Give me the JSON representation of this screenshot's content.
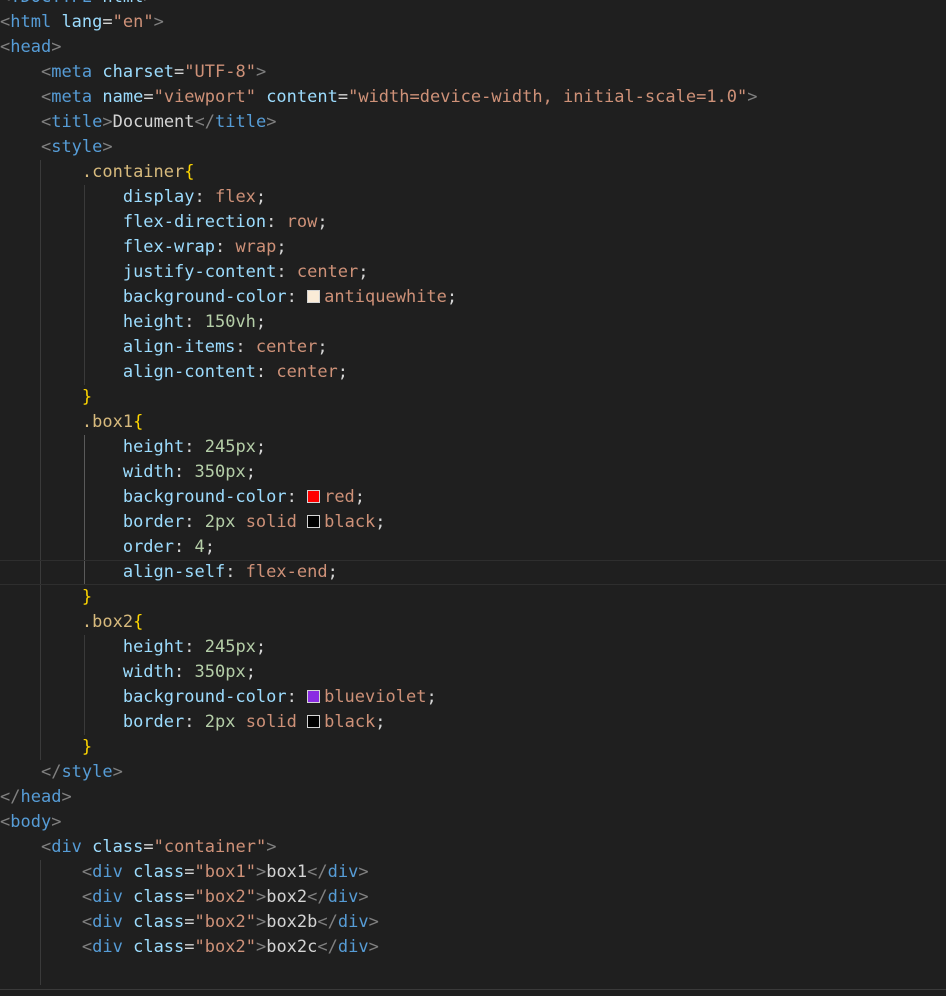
{
  "colors": {
    "background": "#1f1f1f",
    "tag": "#569cd6",
    "attribute": "#9cdcfe",
    "string": "#ce9178",
    "selector": "#d7ba7d",
    "brace": "#ffd700",
    "number": "#b5cea8",
    "swatch_antiquewhite": "#faebd7",
    "swatch_red": "#ff0000",
    "swatch_black": "#000000",
    "swatch_blueviolet": "#8a2be2"
  },
  "lines": [
    [
      {
        "t": "br",
        "v": "<"
      },
      {
        "t": "tag",
        "v": "!DOCTYPE"
      },
      {
        "t": "attr",
        "v": " html"
      },
      {
        "t": "br",
        "v": ">"
      }
    ],
    [
      {
        "t": "br",
        "v": "<"
      },
      {
        "t": "tag",
        "v": "html"
      },
      {
        "t": "attr",
        "v": " lang"
      },
      {
        "t": "text",
        "v": "="
      },
      {
        "t": "str",
        "v": "\"en\""
      },
      {
        "t": "br",
        "v": ">"
      }
    ],
    [
      {
        "t": "br",
        "v": "<"
      },
      {
        "t": "tag",
        "v": "head"
      },
      {
        "t": "br",
        "v": ">"
      }
    ],
    [
      {
        "t": "text",
        "v": "    "
      },
      {
        "t": "br",
        "v": "<"
      },
      {
        "t": "tag",
        "v": "meta"
      },
      {
        "t": "attr",
        "v": " charset"
      },
      {
        "t": "text",
        "v": "="
      },
      {
        "t": "str",
        "v": "\"UTF-8\""
      },
      {
        "t": "br",
        "v": ">"
      }
    ],
    [
      {
        "t": "text",
        "v": "    "
      },
      {
        "t": "br",
        "v": "<"
      },
      {
        "t": "tag",
        "v": "meta"
      },
      {
        "t": "attr",
        "v": " name"
      },
      {
        "t": "text",
        "v": "="
      },
      {
        "t": "str",
        "v": "\"viewport\""
      },
      {
        "t": "attr",
        "v": " content"
      },
      {
        "t": "text",
        "v": "="
      },
      {
        "t": "str",
        "v": "\"width=device-width, initial-scale=1.0\""
      },
      {
        "t": "br",
        "v": ">"
      }
    ],
    [
      {
        "t": "text",
        "v": "    "
      },
      {
        "t": "br",
        "v": "<"
      },
      {
        "t": "tag",
        "v": "title"
      },
      {
        "t": "br",
        "v": ">"
      },
      {
        "t": "text",
        "v": "Document"
      },
      {
        "t": "br",
        "v": "</"
      },
      {
        "t": "tag",
        "v": "title"
      },
      {
        "t": "br",
        "v": ">"
      }
    ],
    [
      {
        "t": "text",
        "v": "    "
      },
      {
        "t": "br",
        "v": "<"
      },
      {
        "t": "tag",
        "v": "style"
      },
      {
        "t": "br",
        "v": ">"
      }
    ],
    [
      {
        "t": "text",
        "v": "        "
      },
      {
        "t": "sel",
        "v": ".container"
      },
      {
        "t": "brace",
        "v": "{"
      }
    ],
    [
      {
        "t": "text",
        "v": "            "
      },
      {
        "t": "prop",
        "v": "display"
      },
      {
        "t": "text",
        "v": ": "
      },
      {
        "t": "val",
        "v": "flex"
      },
      {
        "t": "text",
        "v": ";"
      }
    ],
    [
      {
        "t": "text",
        "v": "            "
      },
      {
        "t": "prop",
        "v": "flex-direction"
      },
      {
        "t": "text",
        "v": ": "
      },
      {
        "t": "val",
        "v": "row"
      },
      {
        "t": "text",
        "v": ";"
      }
    ],
    [
      {
        "t": "text",
        "v": "            "
      },
      {
        "t": "prop",
        "v": "flex-wrap"
      },
      {
        "t": "text",
        "v": ": "
      },
      {
        "t": "val",
        "v": "wrap"
      },
      {
        "t": "text",
        "v": ";"
      }
    ],
    [
      {
        "t": "text",
        "v": "            "
      },
      {
        "t": "prop",
        "v": "justify-content"
      },
      {
        "t": "text",
        "v": ": "
      },
      {
        "t": "val",
        "v": "center"
      },
      {
        "t": "text",
        "v": ";"
      }
    ],
    [
      {
        "t": "text",
        "v": "            "
      },
      {
        "t": "prop",
        "v": "background-color"
      },
      {
        "t": "text",
        "v": ": "
      },
      {
        "t": "swatch",
        "v": "#faebd7"
      },
      {
        "t": "val",
        "v": "antiquewhite"
      },
      {
        "t": "text",
        "v": ";"
      }
    ],
    [
      {
        "t": "text",
        "v": "            "
      },
      {
        "t": "prop",
        "v": "height"
      },
      {
        "t": "text",
        "v": ": "
      },
      {
        "t": "num",
        "v": "150vh"
      },
      {
        "t": "text",
        "v": ";"
      }
    ],
    [
      {
        "t": "text",
        "v": "            "
      },
      {
        "t": "prop",
        "v": "align-items"
      },
      {
        "t": "text",
        "v": ": "
      },
      {
        "t": "val",
        "v": "center"
      },
      {
        "t": "text",
        "v": ";"
      }
    ],
    [
      {
        "t": "text",
        "v": "            "
      },
      {
        "t": "prop",
        "v": "align-content"
      },
      {
        "t": "text",
        "v": ": "
      },
      {
        "t": "val",
        "v": "center"
      },
      {
        "t": "text",
        "v": ";"
      }
    ],
    [
      {
        "t": "text",
        "v": "        "
      },
      {
        "t": "brace",
        "v": "}"
      }
    ],
    [
      {
        "t": "text",
        "v": "        "
      },
      {
        "t": "sel",
        "v": ".box1"
      },
      {
        "t": "brace",
        "v": "{"
      }
    ],
    [
      {
        "t": "text",
        "v": "            "
      },
      {
        "t": "prop",
        "v": "height"
      },
      {
        "t": "text",
        "v": ": "
      },
      {
        "t": "num",
        "v": "245px"
      },
      {
        "t": "text",
        "v": ";"
      }
    ],
    [
      {
        "t": "text",
        "v": "            "
      },
      {
        "t": "prop",
        "v": "width"
      },
      {
        "t": "text",
        "v": ": "
      },
      {
        "t": "num",
        "v": "350px"
      },
      {
        "t": "text",
        "v": ";"
      }
    ],
    [
      {
        "t": "text",
        "v": "            "
      },
      {
        "t": "prop",
        "v": "background-color"
      },
      {
        "t": "text",
        "v": ": "
      },
      {
        "t": "swatch",
        "v": "#ff0000"
      },
      {
        "t": "val",
        "v": "red"
      },
      {
        "t": "text",
        "v": ";"
      }
    ],
    [
      {
        "t": "text",
        "v": "            "
      },
      {
        "t": "prop",
        "v": "border"
      },
      {
        "t": "text",
        "v": ": "
      },
      {
        "t": "num",
        "v": "2px"
      },
      {
        "t": "val",
        "v": " solid "
      },
      {
        "t": "swatch",
        "v": "#000000"
      },
      {
        "t": "val",
        "v": "black"
      },
      {
        "t": "text",
        "v": ";"
      }
    ],
    [
      {
        "t": "text",
        "v": "            "
      },
      {
        "t": "prop",
        "v": "order"
      },
      {
        "t": "text",
        "v": ": "
      },
      {
        "t": "num",
        "v": "4"
      },
      {
        "t": "text",
        "v": ";"
      }
    ],
    [
      {
        "t": "text",
        "v": "            "
      },
      {
        "t": "prop",
        "v": "align-self"
      },
      {
        "t": "text",
        "v": ": "
      },
      {
        "t": "val",
        "v": "flex-end"
      },
      {
        "t": "text",
        "v": ";"
      }
    ],
    [
      {
        "t": "text",
        "v": "        "
      },
      {
        "t": "brace",
        "v": "}"
      }
    ],
    [
      {
        "t": "text",
        "v": "        "
      },
      {
        "t": "sel",
        "v": ".box2"
      },
      {
        "t": "brace",
        "v": "{"
      }
    ],
    [
      {
        "t": "text",
        "v": "            "
      },
      {
        "t": "prop",
        "v": "height"
      },
      {
        "t": "text",
        "v": ": "
      },
      {
        "t": "num",
        "v": "245px"
      },
      {
        "t": "text",
        "v": ";"
      }
    ],
    [
      {
        "t": "text",
        "v": "            "
      },
      {
        "t": "prop",
        "v": "width"
      },
      {
        "t": "text",
        "v": ": "
      },
      {
        "t": "num",
        "v": "350px"
      },
      {
        "t": "text",
        "v": ";"
      }
    ],
    [
      {
        "t": "text",
        "v": "            "
      },
      {
        "t": "prop",
        "v": "background-color"
      },
      {
        "t": "text",
        "v": ": "
      },
      {
        "t": "swatch",
        "v": "#8a2be2"
      },
      {
        "t": "val",
        "v": "blueviolet"
      },
      {
        "t": "text",
        "v": ";"
      }
    ],
    [
      {
        "t": "text",
        "v": "            "
      },
      {
        "t": "prop",
        "v": "border"
      },
      {
        "t": "text",
        "v": ": "
      },
      {
        "t": "num",
        "v": "2px"
      },
      {
        "t": "val",
        "v": " solid "
      },
      {
        "t": "swatch",
        "v": "#000000"
      },
      {
        "t": "val",
        "v": "black"
      },
      {
        "t": "text",
        "v": ";"
      }
    ],
    [
      {
        "t": "text",
        "v": "        "
      },
      {
        "t": "brace",
        "v": "}"
      }
    ],
    [
      {
        "t": "text",
        "v": "    "
      },
      {
        "t": "br",
        "v": "</"
      },
      {
        "t": "tag",
        "v": "style"
      },
      {
        "t": "br",
        "v": ">"
      }
    ],
    [
      {
        "t": "br",
        "v": "</"
      },
      {
        "t": "tag",
        "v": "head"
      },
      {
        "t": "br",
        "v": ">"
      }
    ],
    [
      {
        "t": "br",
        "v": "<"
      },
      {
        "t": "tag",
        "v": "body"
      },
      {
        "t": "br",
        "v": ">"
      }
    ],
    [
      {
        "t": "text",
        "v": "    "
      },
      {
        "t": "br",
        "v": "<"
      },
      {
        "t": "tag",
        "v": "div"
      },
      {
        "t": "attr",
        "v": " class"
      },
      {
        "t": "text",
        "v": "="
      },
      {
        "t": "str",
        "v": "\"container\""
      },
      {
        "t": "br",
        "v": ">"
      }
    ],
    [
      {
        "t": "text",
        "v": "        "
      },
      {
        "t": "br",
        "v": "<"
      },
      {
        "t": "tag",
        "v": "div"
      },
      {
        "t": "attr",
        "v": " class"
      },
      {
        "t": "text",
        "v": "="
      },
      {
        "t": "str",
        "v": "\"box1\""
      },
      {
        "t": "br",
        "v": ">"
      },
      {
        "t": "text",
        "v": "box1"
      },
      {
        "t": "br",
        "v": "</"
      },
      {
        "t": "tag",
        "v": "div"
      },
      {
        "t": "br",
        "v": ">"
      }
    ],
    [
      {
        "t": "text",
        "v": "        "
      },
      {
        "t": "br",
        "v": "<"
      },
      {
        "t": "tag",
        "v": "div"
      },
      {
        "t": "attr",
        "v": " class"
      },
      {
        "t": "text",
        "v": "="
      },
      {
        "t": "str",
        "v": "\"box2\""
      },
      {
        "t": "br",
        "v": ">"
      },
      {
        "t": "text",
        "v": "box2"
      },
      {
        "t": "br",
        "v": "</"
      },
      {
        "t": "tag",
        "v": "div"
      },
      {
        "t": "br",
        "v": ">"
      }
    ],
    [
      {
        "t": "text",
        "v": "        "
      },
      {
        "t": "br",
        "v": "<"
      },
      {
        "t": "tag",
        "v": "div"
      },
      {
        "t": "attr",
        "v": " class"
      },
      {
        "t": "text",
        "v": "="
      },
      {
        "t": "str",
        "v": "\"box2\""
      },
      {
        "t": "br",
        "v": ">"
      },
      {
        "t": "text",
        "v": "box2b"
      },
      {
        "t": "br",
        "v": "</"
      },
      {
        "t": "tag",
        "v": "div"
      },
      {
        "t": "br",
        "v": ">"
      }
    ],
    [
      {
        "t": "text",
        "v": "        "
      },
      {
        "t": "br",
        "v": "<"
      },
      {
        "t": "tag",
        "v": "div"
      },
      {
        "t": "attr",
        "v": " class"
      },
      {
        "t": "text",
        "v": "="
      },
      {
        "t": "str",
        "v": "\"box2\""
      },
      {
        "t": "br",
        "v": ">"
      },
      {
        "t": "text",
        "v": "box2c"
      },
      {
        "t": "br",
        "v": "</"
      },
      {
        "t": "tag",
        "v": "div"
      },
      {
        "t": "br",
        "v": ">"
      }
    ],
    []
  ]
}
